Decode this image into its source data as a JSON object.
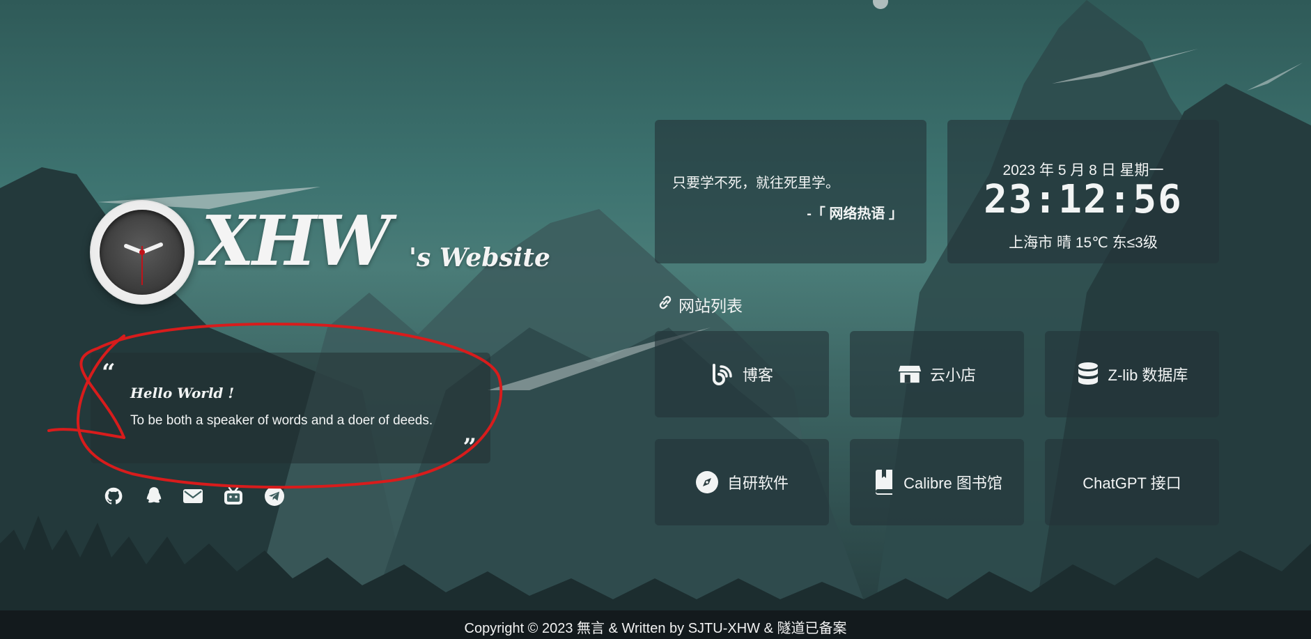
{
  "logo": {
    "title": "XHW",
    "subtitle": "'s Website"
  },
  "quote": {
    "open_mark": "“",
    "close_mark": "”",
    "heading": "Hello World !",
    "text": "To be both a speaker of words and a doer of deeds."
  },
  "socials": [
    {
      "icon": "github-icon"
    },
    {
      "icon": "qq-icon"
    },
    {
      "icon": "mail-icon"
    },
    {
      "icon": "bilibili-icon"
    },
    {
      "icon": "telegram-icon"
    }
  ],
  "hitokoto": {
    "text": "只要学不死，就往死里学。",
    "from": "-「 网络热语 」"
  },
  "time": {
    "date": "2023 年 5 月 8 日 星期一",
    "clock": "23:12:56",
    "weather": "上海市 晴 15℃ 东≤3级"
  },
  "site_list": {
    "title": "网站列表",
    "links": [
      {
        "label": "博客",
        "icon": "blog-icon"
      },
      {
        "label": "云小店",
        "icon": "store-icon"
      },
      {
        "label": "Z-lib 数据库",
        "icon": "database-icon"
      },
      {
        "label": "自研软件",
        "icon": "compass-icon"
      },
      {
        "label": "Calibre 图书馆",
        "icon": "book-icon"
      },
      {
        "label": "ChatGPT 接口",
        "icon": ""
      }
    ]
  },
  "footer": {
    "text": "Copyright © 2023 無言 & Written by SJTU-XHW & 隧道已备案"
  },
  "colors": {
    "sky_top": "#2f5a58",
    "sky_mid": "#4a7c78",
    "card_bg": "#243438",
    "annotation": "#d81c1c",
    "clock_hand_red": "#c0131a"
  }
}
